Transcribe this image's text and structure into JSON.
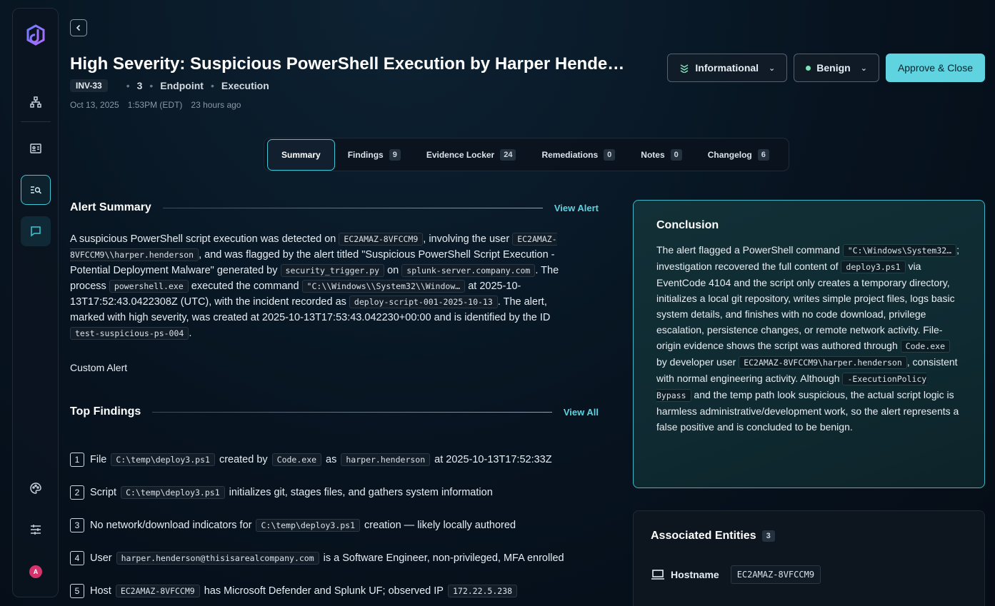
{
  "header": {
    "title": "High Severity: Suspicious PowerShell Execution by Harper Hende…",
    "inv_id": "INV-33",
    "count": "3",
    "category1": "Endpoint",
    "category2": "Execution",
    "date": "Oct 13, 2025",
    "time": "1:53PM (EDT)",
    "relative": "23 hours ago",
    "severity_label": "Informational",
    "verdict_label": "Benign",
    "approve_label": "Approve & Close"
  },
  "tabs": [
    {
      "label": "Summary",
      "count": ""
    },
    {
      "label": "Findings",
      "count": "9"
    },
    {
      "label": "Evidence Locker",
      "count": "24"
    },
    {
      "label": "Remediations",
      "count": "0"
    },
    {
      "label": "Notes",
      "count": "0"
    },
    {
      "label": "Changelog",
      "count": "6"
    }
  ],
  "alert_summary": {
    "heading": "Alert Summary",
    "link": "View Alert",
    "t1": "A suspicious PowerShell script execution was detected on ",
    "c_host": "EC2AMAZ-8VFCCM9",
    "t2": ", involving the user ",
    "c_user": "EC2AMAZ-8VFCCM9\\\\harper.henderson",
    "t3": ", and was flagged by the alert titled \"Suspicious PowerShell Script Execution - Potential Deployment Malware\" generated by ",
    "c_trigger": "security_trigger.py",
    "t4": " on ",
    "c_server": "splunk-server.company.com",
    "t5": ". The process ",
    "c_proc": "powershell.exe",
    "t6": " executed the command ",
    "c_cmd": "\"C:\\\\Windows\\\\System32\\\\Window…",
    "t7": " at 2025-10-13T17:52:43.0422308Z (UTC), with the incident recorded as ",
    "c_incident": "deploy-script-001-2025-10-13",
    "t8": ". The alert, marked with high severity, was created at 2025-10-13T17:53:43.042230+00:00 and is identified by the ID ",
    "c_id": "test-suspicious-ps-004",
    "t9": ".",
    "custom_alert": "Custom Alert"
  },
  "top_findings": {
    "heading": "Top Findings",
    "link": "View All",
    "items": [
      {
        "n": "1",
        "parts": [
          "File ",
          "C:\\temp\\deploy3.ps1",
          " created by ",
          "Code.exe",
          " as ",
          "harper.henderson",
          " at 2025-10-13T17:52:33Z"
        ]
      },
      {
        "n": "2",
        "parts": [
          "Script ",
          "C:\\temp\\deploy3.ps1",
          " initializes git, stages files, and gathers system information"
        ]
      },
      {
        "n": "3",
        "parts": [
          "No network/download indicators for ",
          "C:\\temp\\deploy3.ps1",
          " creation — likely locally authored"
        ]
      },
      {
        "n": "4",
        "parts": [
          "User ",
          "harper.henderson@thisisarealcompany.com",
          " is a Software Engineer, non-privileged, MFA enrolled"
        ]
      },
      {
        "n": "5",
        "parts": [
          "Host ",
          "EC2AMAZ-8VFCCM9",
          " has Microsoft Defender and Splunk UF; observed IP ",
          "172.22.5.238",
          ""
        ]
      }
    ]
  },
  "conclusion": {
    "heading": "Conclusion",
    "t1": "The alert flagged a PowerShell command ",
    "c1": "\"C:\\Windows\\System32…",
    "t2": "; investigation recovered the full content of ",
    "c2": "deploy3.ps1",
    "t3": " via EventCode 4104 and the script only creates a temporary directory, initializes a local git repository, writes simple project files, logs basic system details, and finishes with no code download, privilege escalation, persistence changes, or remote network activity. File-origin evidence shows the script was authored through ",
    "c3": "Code.exe",
    "t4": " by developer user ",
    "c4": "EC2AMAZ-8VFCCM9\\harper.henderson",
    "t5": ", consistent with normal engineering activity. Although ",
    "c5": "-ExecutionPolicy Bypass",
    "t6": " and the temp path look suspicious, the actual script logic is harmless administrative/development work, so the alert represents a false positive and is concluded to be benign."
  },
  "entities": {
    "heading": "Associated Entities",
    "count": "3",
    "hostname_label": "Hostname",
    "hostname_value": "EC2AMAZ-8VFCCM9"
  },
  "sidebar": {
    "avatar_initial": "A"
  }
}
